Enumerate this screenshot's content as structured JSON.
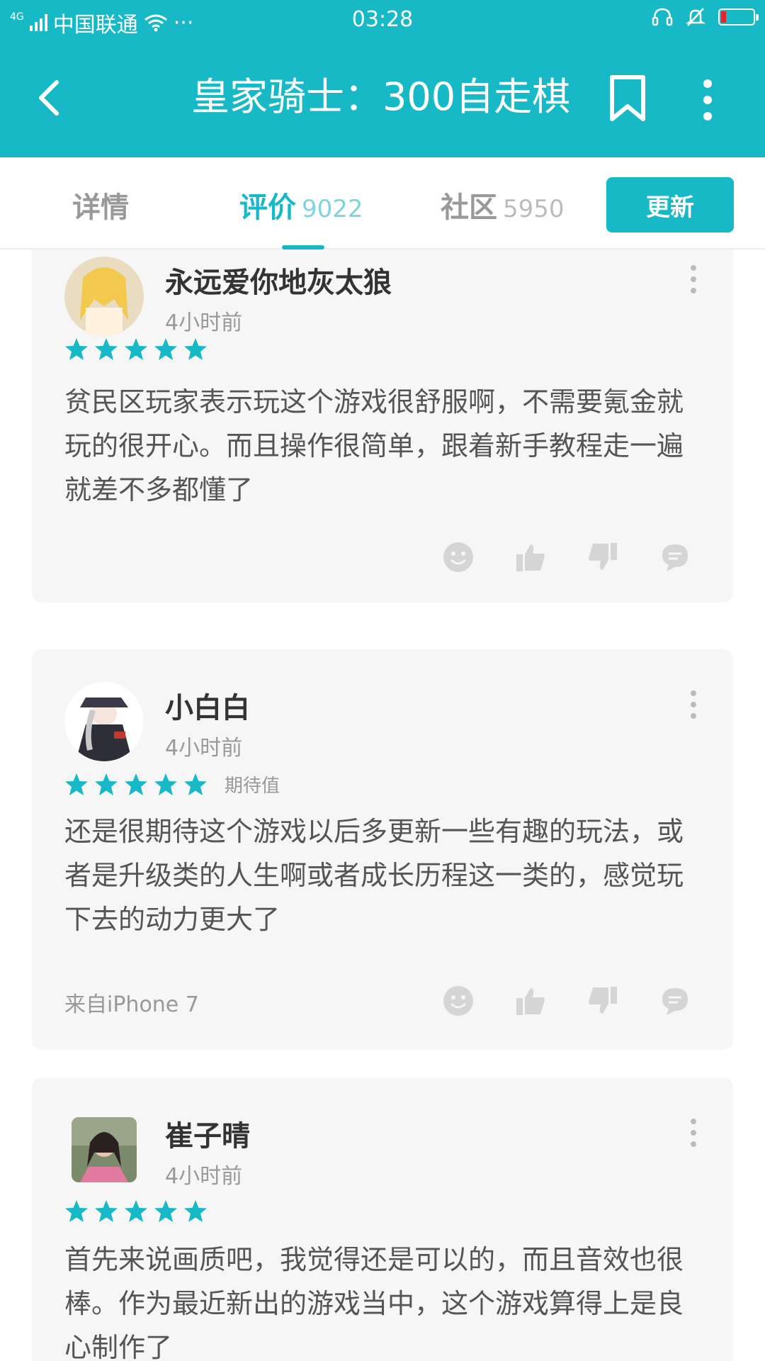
{
  "status_bar": {
    "network": "4G",
    "carrier": "中国联通",
    "dots": "···",
    "time": "03:28",
    "battery_level": 0.15,
    "battery_color": "#e6232a"
  },
  "app_bar": {
    "title": "皇家骑士：300自走棋",
    "background": "#17b9c7"
  },
  "tabs": [
    {
      "label": "详情",
      "count": ""
    },
    {
      "label": "评价",
      "count": "9022"
    },
    {
      "label": "社区",
      "count": "5950"
    }
  ],
  "active_tab": "评价",
  "update_button": {
    "label": "更新"
  },
  "reviews": [
    {
      "username": "永远爱你地灰太狼",
      "time": "4小时前",
      "rating": 5,
      "tag": "",
      "text": "贫民区玩家表示玩这个游戏很舒服啊，不需要氪金就玩的很开心。而且操作很简单，跟着新手教程走一遍就差不多都懂了",
      "device": ""
    },
    {
      "username": "小白白",
      "time": "4小时前",
      "rating": 5,
      "tag": "期待值",
      "text": "还是很期待这个游戏以后多更新一些有趣的玩法，或者是升级类的人生啊或者成长历程这一类的，感觉玩下去的动力更大了",
      "device": "来自iPhone 7"
    },
    {
      "username": "崔子晴",
      "time": "4小时前",
      "rating": 5,
      "tag": "",
      "text": "首先来说画质吧，我觉得还是可以的，而且音效也很棒。作为最近新出的游戏当中，这个游戏算得上是良心制作了",
      "device": ""
    }
  ]
}
